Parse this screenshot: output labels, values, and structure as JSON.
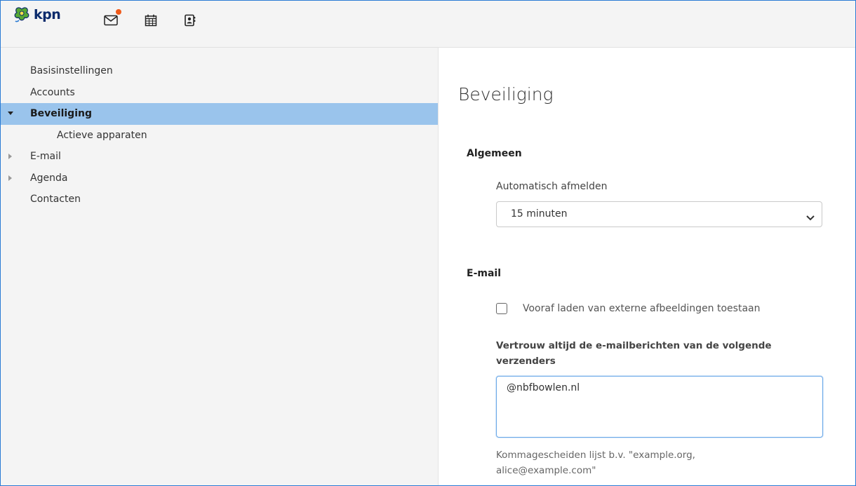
{
  "header": {
    "logo_text": "kpn",
    "icons": [
      "mail-icon",
      "calendar-icon",
      "contacts-icon"
    ],
    "mail_badge_color": "#f05a1a"
  },
  "sidebar": {
    "items": [
      {
        "label": "Basisinstellingen"
      },
      {
        "label": "Accounts"
      },
      {
        "label": "Beveiliging",
        "selected": true,
        "expanded": true
      },
      {
        "label": "Actieve apparaten",
        "sub": true
      },
      {
        "label": "E-mail",
        "collapsed": true
      },
      {
        "label": "Agenda",
        "collapsed": true
      },
      {
        "label": "Contacten"
      }
    ],
    "selected_color": "#9ac4ec"
  },
  "main": {
    "title": "Beveiliging",
    "general": {
      "heading": "Algemeen",
      "autologout_label": "Automatisch afmelden",
      "autologout_value": "15 minuten"
    },
    "email": {
      "heading": "E-mail",
      "preload_label": "Vooraf laden van externe afbeeldingen toestaan",
      "preload_checked": false,
      "trust_label": "Vertrouw altijd de e-mailberichten van de volgende verzenders",
      "trust_value": "@nbfbowlen.nl",
      "trust_help": "Kommagescheiden lijst b.v. \"example.org, alice@example.com\""
    }
  }
}
